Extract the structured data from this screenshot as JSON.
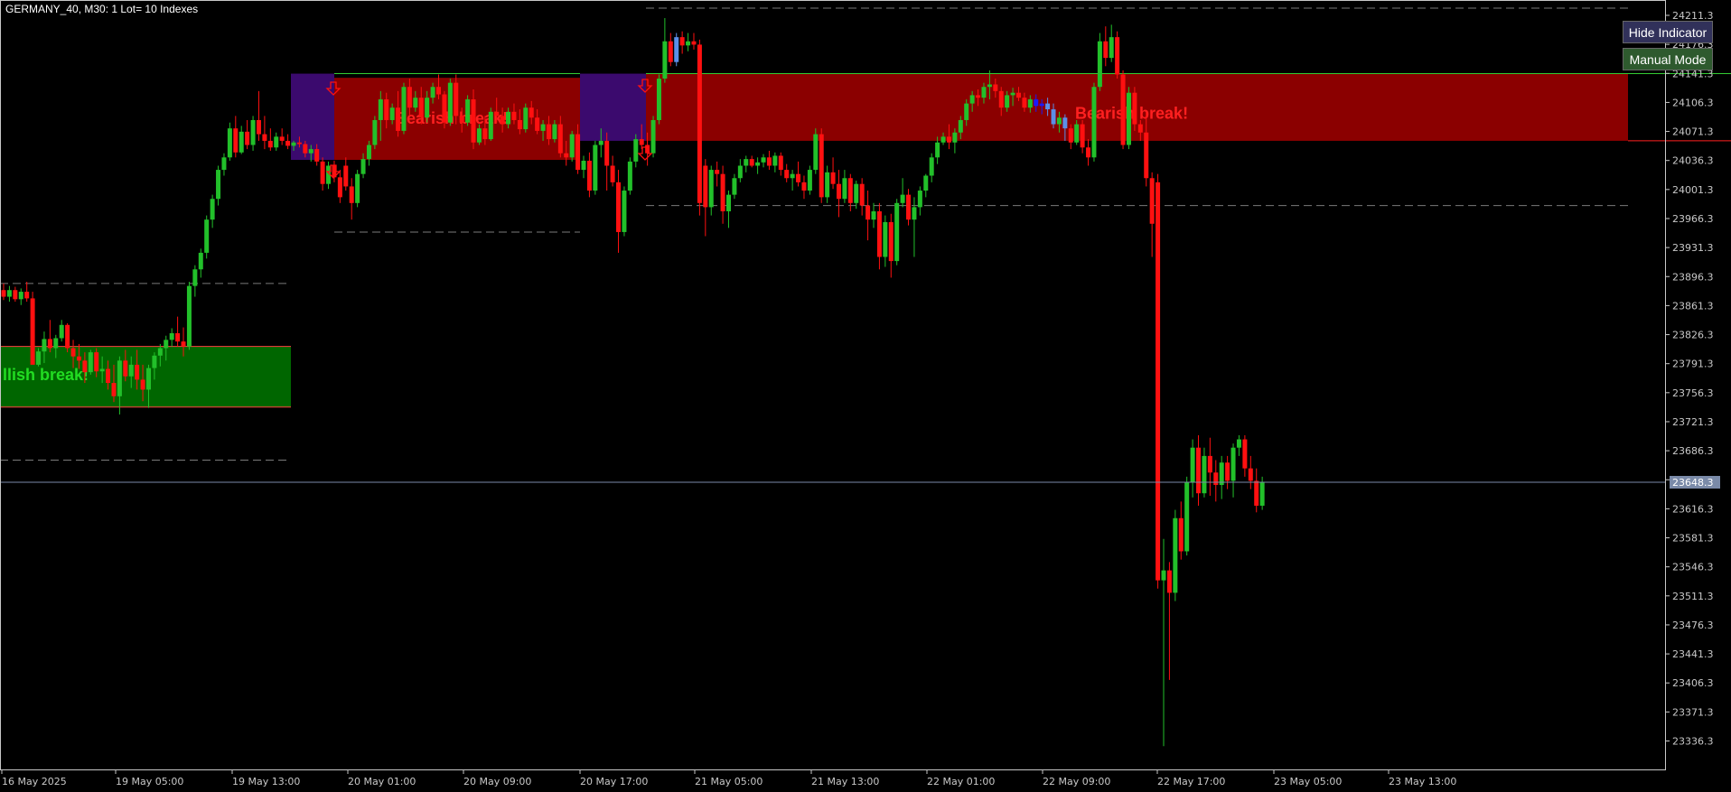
{
  "header": {
    "symbol_title": "GERMANY_40, M30:  1 Lot= 10 Indexes"
  },
  "buttons": {
    "hide_indicator": "Hide Indicator",
    "manual_mode": "Manual Mode"
  },
  "price_axis": {
    "ticks": [
      "24211.3",
      "24176.3",
      "24141.3",
      "24106.3",
      "24071.3",
      "24036.3",
      "24001.3",
      "23966.3",
      "23931.3",
      "23896.3",
      "23861.3",
      "23826.3",
      "23791.3",
      "23756.3",
      "23721.3",
      "23686.3",
      "23651.3",
      "23616.3",
      "23581.3",
      "23546.3",
      "23511.3",
      "23476.3",
      "23441.3",
      "23406.3",
      "23371.3",
      "23336.3"
    ],
    "current_price": "23648.3",
    "min": 23312,
    "max": 24225
  },
  "time_axis": {
    "labels": [
      "16 May 2025",
      "19 May 05:00",
      "19 May 13:00",
      "20 May 01:00",
      "20 May 09:00",
      "20 May 17:00",
      "21 May 05:00",
      "21 May 13:00",
      "22 May 01:00",
      "22 May 09:00",
      "22 May 17:00",
      "23 May 05:00",
      "23 May 13:00"
    ]
  },
  "zones": [
    {
      "type": "bullish",
      "label": "llish break!",
      "top": 23812,
      "bottom": 23739,
      "color": "#006600",
      "label_color": "#22dd22"
    },
    {
      "type": "bearish",
      "label": "Bearish break!",
      "top": 24136,
      "bottom": 24037,
      "color": "#8b0000",
      "label_color": "#ff2020"
    },
    {
      "type": "bearish",
      "label": "Bearish break!",
      "top": 24141,
      "bottom": 24060,
      "color": "#8b0000",
      "label_color": "#ff2020"
    }
  ],
  "colors": {
    "bull": "#22c02a",
    "bear": "#ff1010",
    "blue": "#1a1aff",
    "light_blue": "#5b8fe8",
    "purple": "#3b0a6e",
    "grid_dash": "#7a7a7a",
    "axis": "#c8c8c8",
    "price_line": "#7a8aa8"
  },
  "chart_data": {
    "type": "candlestick",
    "title": "GERMANY_40, M30",
    "ylim": [
      23312,
      24225
    ],
    "candles": [
      [
        23880,
        23888,
        23868,
        23872
      ],
      [
        23872,
        23885,
        23866,
        23880
      ],
      [
        23880,
        23884,
        23866,
        23869
      ],
      [
        23869,
        23882,
        23862,
        23878
      ],
      [
        23878,
        23890,
        23866,
        23870
      ],
      [
        23870,
        23878,
        23820,
        23790
      ],
      [
        23790,
        23810,
        23788,
        23806
      ],
      [
        23806,
        23830,
        23792,
        23821
      ],
      [
        23821,
        23844,
        23805,
        23810
      ],
      [
        23810,
        23826,
        23798,
        23822
      ],
      [
        23822,
        23844,
        23818,
        23838
      ],
      [
        23838,
        23840,
        23805,
        23810
      ],
      [
        23810,
        23820,
        23786,
        23800
      ],
      [
        23800,
        23815,
        23785,
        23795
      ],
      [
        23795,
        23805,
        23768,
        23781
      ],
      [
        23781,
        23808,
        23778,
        23805
      ],
      [
        23805,
        23810,
        23775,
        23782
      ],
      [
        23782,
        23800,
        23768,
        23785
      ],
      [
        23785,
        23795,
        23760,
        23768
      ],
      [
        23768,
        23790,
        23745,
        23752
      ],
      [
        23752,
        23800,
        23730,
        23795
      ],
      [
        23795,
        23808,
        23770,
        23776
      ],
      [
        23776,
        23800,
        23762,
        23790
      ],
      [
        23790,
        23808,
        23760,
        23772
      ],
      [
        23772,
        23790,
        23746,
        23760
      ],
      [
        23760,
        23790,
        23738,
        23786
      ],
      [
        23786,
        23805,
        23772,
        23801
      ],
      [
        23801,
        23815,
        23788,
        23810
      ],
      [
        23810,
        23825,
        23795,
        23820
      ],
      [
        23820,
        23834,
        23812,
        23828
      ],
      [
        23828,
        23848,
        23812,
        23818
      ],
      [
        23818,
        23835,
        23800,
        23812
      ],
      [
        23812,
        23890,
        23808,
        23885
      ],
      [
        23885,
        23910,
        23872,
        23905
      ],
      [
        23905,
        23930,
        23895,
        23925
      ],
      [
        23925,
        23970,
        23918,
        23965
      ],
      [
        23965,
        23995,
        23955,
        23990
      ],
      [
        23990,
        24030,
        23982,
        24025
      ],
      [
        24025,
        24045,
        24018,
        24040
      ],
      [
        24040,
        24082,
        24036,
        24075
      ],
      [
        24075,
        24090,
        24040,
        24046
      ],
      [
        24046,
        24078,
        24044,
        24071
      ],
      [
        24071,
        24085,
        24050,
        24055
      ],
      [
        24055,
        24090,
        24048,
        24085
      ],
      [
        24085,
        24120,
        24060,
        24068
      ],
      [
        24068,
        24090,
        24050,
        24060
      ],
      [
        24060,
        24075,
        24048,
        24052
      ],
      [
        24052,
        24070,
        24048,
        24065
      ],
      [
        24065,
        24075,
        24055,
        24060
      ],
      [
        24060,
        24068,
        24050,
        24054
      ],
      [
        24054,
        24060,
        24048,
        24058
      ],
      [
        24058,
        24065,
        24052,
        24056
      ],
      [
        24056,
        24060,
        24040,
        24045
      ],
      [
        24045,
        24055,
        24035,
        24050
      ],
      [
        24050,
        24056,
        24030,
        24035
      ],
      [
        24035,
        24040,
        24000,
        24008
      ],
      [
        24008,
        24035,
        24002,
        24030
      ],
      [
        24030,
        24036,
        24010,
        24016
      ],
      [
        24016,
        24025,
        23985,
        23992
      ],
      [
        24030,
        24040,
        24000,
        24005
      ],
      [
        24005,
        24015,
        23965,
        23985
      ],
      [
        23985,
        24025,
        23980,
        24020
      ],
      [
        24020,
        24045,
        24015,
        24038
      ],
      [
        24038,
        24060,
        24030,
        24055
      ],
      [
        24055,
        24090,
        24050,
        24085
      ],
      [
        24085,
        24120,
        24060,
        24110
      ],
      [
        24110,
        24118,
        24075,
        24085
      ],
      [
        24085,
        24105,
        24080,
        24100
      ],
      [
        24100,
        24120,
        24065,
        24072
      ],
      [
        24072,
        24130,
        24068,
        24125
      ],
      [
        24125,
        24135,
        24090,
        24100
      ],
      [
        24100,
        24120,
        24095,
        24112
      ],
      [
        24112,
        24125,
        24080,
        24088
      ],
      [
        24088,
        24120,
        24082,
        24112
      ],
      [
        24112,
        24130,
        24105,
        24125
      ],
      [
        24125,
        24140,
        24110,
        24116
      ],
      [
        24116,
        24120,
        24075,
        24082
      ],
      [
        24082,
        24135,
        24078,
        24130
      ],
      [
        24130,
        24140,
        24080,
        24090
      ],
      [
        24090,
        24100,
        24070,
        24082
      ],
      [
        24082,
        24115,
        24078,
        24110
      ],
      [
        24110,
        24122,
        24050,
        24058
      ],
      [
        24058,
        24080,
        24055,
        24075
      ],
      [
        24075,
        24090,
        24055,
        24062
      ],
      [
        24062,
        24100,
        24060,
        24095
      ],
      [
        24095,
        24112,
        24082,
        24090
      ],
      [
        24090,
        24100,
        24070,
        24080
      ],
      [
        24080,
        24100,
        24075,
        24095
      ],
      [
        24095,
        24105,
        24080,
        24085
      ],
      [
        24085,
        24098,
        24068,
        24074
      ],
      [
        24074,
        24105,
        24070,
        24100
      ],
      [
        24100,
        24108,
        24080,
        24088
      ],
      [
        24088,
        24098,
        24068,
        24072
      ],
      [
        24072,
        24085,
        24060,
        24080
      ],
      [
        24080,
        24090,
        24055,
        24062
      ],
      [
        24062,
        24085,
        24058,
        24080
      ],
      [
        24080,
        24090,
        24040,
        24045
      ],
      [
        24045,
        24060,
        24030,
        24040
      ],
      [
        24040,
        24072,
        24035,
        24068
      ],
      [
        24068,
        24080,
        24020,
        24025
      ],
      [
        24025,
        24042,
        24015,
        24036
      ],
      [
        24036,
        24046,
        23992,
        24000
      ],
      [
        24000,
        24060,
        23995,
        24055
      ],
      [
        24055,
        24075,
        24040,
        24060
      ],
      [
        24060,
        24070,
        24000,
        24030
      ],
      [
        24030,
        24042,
        24005,
        24010
      ],
      [
        24010,
        24025,
        23925,
        23950
      ],
      [
        23950,
        24005,
        23945,
        24000
      ],
      [
        24000,
        24040,
        23995,
        24035
      ],
      [
        24035,
        24068,
        24028,
        24062
      ],
      [
        24062,
        24080,
        24050,
        24055
      ],
      [
        24055,
        24070,
        24030,
        24045
      ],
      [
        24045,
        24090,
        24040,
        24085
      ],
      [
        24085,
        24140,
        24080,
        24135
      ],
      [
        24135,
        24208,
        24130,
        24180
      ],
      [
        24180,
        24190,
        24150,
        24155
      ],
      [
        24155,
        24190,
        24150,
        24185
      ],
      [
        24185,
        24192,
        24165,
        24175
      ],
      [
        24175,
        24190,
        24168,
        24180
      ],
      [
        24180,
        24190,
        24170,
        24176
      ],
      [
        24176,
        24182,
        23970,
        23985
      ],
      [
        24030,
        24038,
        23945,
        23980
      ],
      [
        23980,
        24030,
        23970,
        24025
      ],
      [
        24025,
        24035,
        24005,
        24020
      ],
      [
        24020,
        24030,
        23960,
        23975
      ],
      [
        23975,
        24000,
        23955,
        23995
      ],
      [
        23995,
        24020,
        23990,
        24015
      ],
      [
        24015,
        24038,
        24010,
        24030
      ],
      [
        24030,
        24042,
        24022,
        24038
      ],
      [
        24038,
        24042,
        24028,
        24030
      ],
      [
        24030,
        24040,
        24020,
        24034
      ],
      [
        24034,
        24044,
        24028,
        24040
      ],
      [
        24040,
        24048,
        24025,
        24030
      ],
      [
        24030,
        24046,
        24022,
        24042
      ],
      [
        24042,
        24046,
        24018,
        24025
      ],
      [
        24025,
        24032,
        24010,
        24015
      ],
      [
        24015,
        24025,
        24000,
        24020
      ],
      [
        24020,
        24035,
        24005,
        24010
      ],
      [
        24010,
        24018,
        23990,
        24000
      ],
      [
        24000,
        24030,
        23995,
        24025
      ],
      [
        24025,
        24075,
        24020,
        24068
      ],
      [
        24068,
        24075,
        23985,
        23992
      ],
      [
        23992,
        24030,
        23985,
        24022
      ],
      [
        24022,
        24040,
        24002,
        24008
      ],
      [
        24008,
        24025,
        23968,
        23990
      ],
      [
        23990,
        24025,
        23985,
        24015
      ],
      [
        24015,
        24020,
        23975,
        23985
      ],
      [
        23985,
        24012,
        23978,
        24008
      ],
      [
        24008,
        24015,
        23970,
        23982
      ],
      [
        23982,
        24000,
        23940,
        23965
      ],
      [
        23965,
        23985,
        23955,
        23975
      ],
      [
        23975,
        23985,
        23905,
        23920
      ],
      [
        23920,
        23970,
        23908,
        23962
      ],
      [
        23962,
        23972,
        23895,
        23915
      ],
      [
        23915,
        23990,
        23910,
        23985
      ],
      [
        23985,
        24015,
        23980,
        23995
      ],
      [
        23995,
        24002,
        23958,
        23965
      ],
      [
        23965,
        23992,
        23920,
        23980
      ],
      [
        23980,
        24005,
        23970,
        24000
      ],
      [
        24000,
        24020,
        23992,
        24018
      ],
      [
        24018,
        24045,
        24010,
        24040
      ],
      [
        24040,
        24065,
        24032,
        24058
      ],
      [
        24058,
        24070,
        24055,
        24065
      ],
      [
        24065,
        24080,
        24050,
        24058
      ],
      [
        24058,
        24075,
        24045,
        24070
      ],
      [
        24070,
        24090,
        24062,
        24085
      ],
      [
        24085,
        24110,
        24078,
        24105
      ],
      [
        24105,
        24120,
        24095,
        24115
      ],
      [
        24115,
        24122,
        24102,
        24112
      ],
      [
        24112,
        24130,
        24105,
        24125
      ],
      [
        24125,
        24145,
        24110,
        24128
      ],
      [
        24128,
        24135,
        24112,
        24120
      ],
      [
        24120,
        24125,
        24090,
        24100
      ],
      [
        24100,
        24120,
        24095,
        24115
      ],
      [
        24115,
        24124,
        24102,
        24118
      ],
      [
        24118,
        24125,
        24108,
        24112
      ],
      [
        24112,
        24118,
        24095,
        24100
      ],
      [
        24100,
        24115,
        24094,
        24110
      ],
      [
        24110,
        24116,
        24095,
        24102
      ],
      [
        24102,
        24110,
        24092,
        24105
      ],
      [
        24105,
        24112,
        24090,
        24098
      ],
      [
        24098,
        24105,
        24075,
        24080
      ],
      [
        24080,
        24095,
        24070,
        24088
      ],
      [
        24088,
        24092,
        24060,
        24075
      ],
      [
        24075,
        24080,
        24050,
        24058
      ],
      [
        24058,
        24085,
        24055,
        24080
      ],
      [
        24080,
        24085,
        24045,
        24052
      ],
      [
        24052,
        24062,
        24030,
        24040
      ],
      [
        24040,
        24130,
        24035,
        24125
      ],
      [
        24125,
        24190,
        24120,
        24180
      ],
      [
        24180,
        24198,
        24150,
        24160
      ],
      [
        24160,
        24200,
        24155,
        24185
      ],
      [
        24185,
        24192,
        24135,
        24140
      ],
      [
        24140,
        24145,
        24050,
        24055
      ],
      [
        24055,
        24125,
        24050,
        24118
      ],
      [
        24118,
        24125,
        24072,
        24080
      ],
      [
        24080,
        24085,
        24060,
        24070
      ],
      [
        24070,
        24095,
        24005,
        24015
      ],
      [
        24015,
        24022,
        23920,
        23960
      ],
      [
        24010,
        24020,
        23520,
        23530
      ],
      [
        23530,
        23580,
        23330,
        23542
      ],
      [
        23542,
        23552,
        23410,
        23515
      ],
      [
        23515,
        23615,
        23505,
        23605
      ],
      [
        23605,
        23625,
        23555,
        23565
      ],
      [
        23565,
        23655,
        23560,
        23648
      ],
      [
        23648,
        23700,
        23630,
        23690
      ],
      [
        23690,
        23705,
        23620,
        23635
      ],
      [
        23635,
        23690,
        23630,
        23680
      ],
      [
        23680,
        23702,
        23632,
        23660
      ],
      [
        23660,
        23675,
        23625,
        23645
      ],
      [
        23645,
        23680,
        23628,
        23672
      ],
      [
        23672,
        23680,
        23640,
        23650
      ],
      [
        23650,
        23695,
        23630,
        23690
      ],
      [
        23690,
        23705,
        23680,
        23700
      ],
      [
        23700,
        23705,
        23655,
        23665
      ],
      [
        23665,
        23680,
        23640,
        23650
      ],
      [
        23650,
        23665,
        23612,
        23620
      ],
      [
        23620,
        23655,
        23615,
        23648
      ]
    ]
  }
}
